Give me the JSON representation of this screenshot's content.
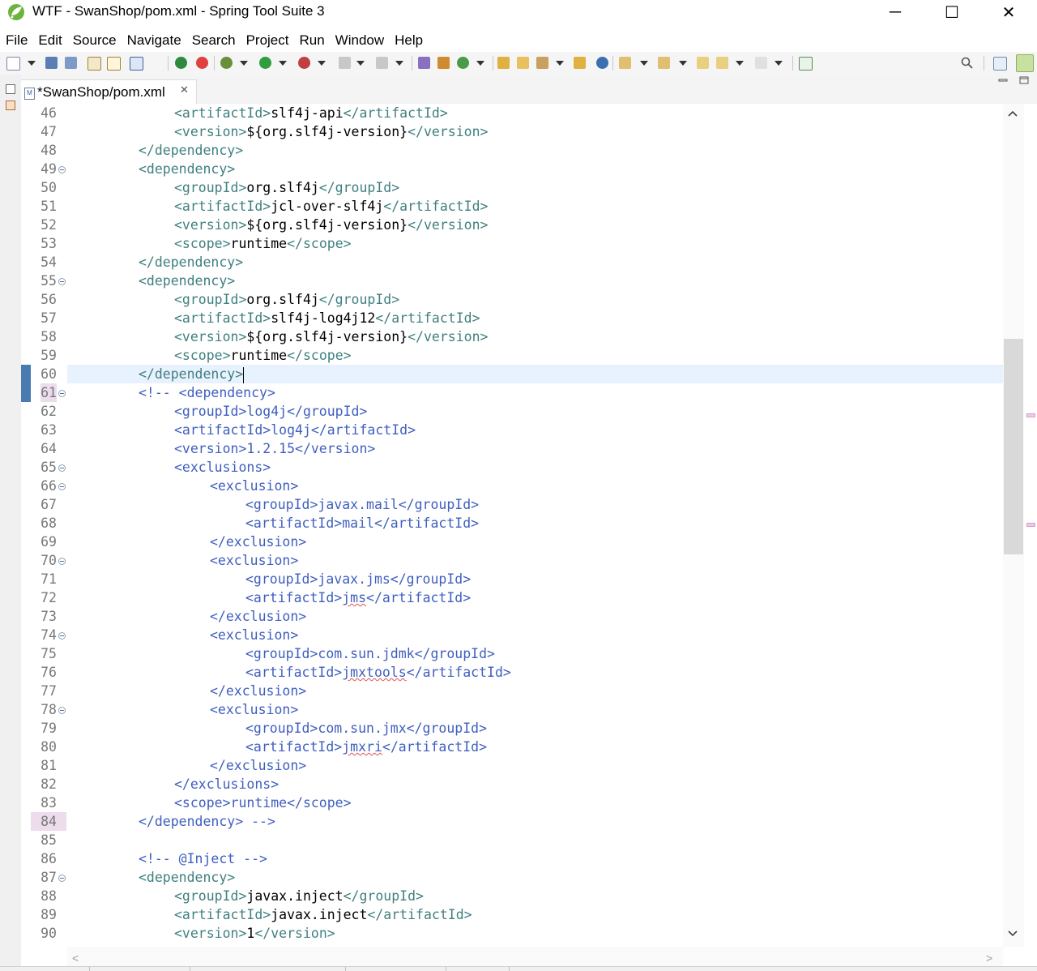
{
  "window": {
    "title": "WTF - SwanShop/pom.xml - Spring Tool Suite 3",
    "minimize_glyph": "─",
    "maximize_glyph": "☐",
    "close_glyph": "✕"
  },
  "menu": [
    "File",
    "Edit",
    "Source",
    "Navigate",
    "Search",
    "Project",
    "Run",
    "Window",
    "Help"
  ],
  "editor_tab": {
    "title": "*SwanShop/pom.xml",
    "file_icon_text": "M",
    "close_glyph": "✕"
  },
  "colors": {
    "tag": "#3f7f7f",
    "text": "#000000",
    "comment": "#3f5fbf",
    "current_line": "#e8f2fe",
    "quick_diff": "#4a7bb0"
  },
  "icons": [
    "spring-logo-icon",
    "new-icon",
    "save-icon",
    "save-all-icon",
    "print-icon",
    "console-icon",
    "skip-breakpoints-icon",
    "debug-icon",
    "run-icon",
    "external-tools-icon",
    "terminate-icon",
    "disconnect-icon",
    "new-class-icon",
    "open-type-icon",
    "refresh-icon",
    "open-folder-icon",
    "search-icon",
    "back-icon",
    "forward-icon",
    "perspective-icon"
  ],
  "editor": {
    "current_line": 60,
    "lines": [
      {
        "n": "46",
        "indent": 3,
        "parts": [
          {
            "t": "<artifactId>",
            "c": "tag"
          },
          {
            "t": "slf4j-api",
            "c": "txt"
          },
          {
            "t": "</artifactId>",
            "c": "tag"
          }
        ]
      },
      {
        "n": "47",
        "indent": 3,
        "parts": [
          {
            "t": "<version>",
            "c": "tag"
          },
          {
            "t": "${org.slf4j-version}",
            "c": "txt"
          },
          {
            "t": "</version>",
            "c": "tag"
          }
        ]
      },
      {
        "n": "48",
        "indent": 2,
        "parts": [
          {
            "t": "</dependency>",
            "c": "tag"
          }
        ]
      },
      {
        "n": "49",
        "indent": 2,
        "fold": true,
        "parts": [
          {
            "t": "<dependency>",
            "c": "tag"
          }
        ]
      },
      {
        "n": "50",
        "indent": 3,
        "parts": [
          {
            "t": "<groupId>",
            "c": "tag"
          },
          {
            "t": "org.slf4j",
            "c": "txt"
          },
          {
            "t": "</groupId>",
            "c": "tag"
          }
        ]
      },
      {
        "n": "51",
        "indent": 3,
        "parts": [
          {
            "t": "<artifactId>",
            "c": "tag"
          },
          {
            "t": "jcl-over-slf4j",
            "c": "txt"
          },
          {
            "t": "</artifactId>",
            "c": "tag"
          }
        ]
      },
      {
        "n": "52",
        "indent": 3,
        "parts": [
          {
            "t": "<version>",
            "c": "tag"
          },
          {
            "t": "${org.slf4j-version}",
            "c": "txt"
          },
          {
            "t": "</version>",
            "c": "tag"
          }
        ]
      },
      {
        "n": "53",
        "indent": 3,
        "parts": [
          {
            "t": "<scope>",
            "c": "tag"
          },
          {
            "t": "runtime",
            "c": "txt"
          },
          {
            "t": "</scope>",
            "c": "tag"
          }
        ]
      },
      {
        "n": "54",
        "indent": 2,
        "parts": [
          {
            "t": "</dependency>",
            "c": "tag"
          }
        ]
      },
      {
        "n": "55",
        "indent": 2,
        "fold": true,
        "parts": [
          {
            "t": "<dependency>",
            "c": "tag"
          }
        ]
      },
      {
        "n": "56",
        "indent": 3,
        "parts": [
          {
            "t": "<groupId>",
            "c": "tag"
          },
          {
            "t": "org.slf4j",
            "c": "txt"
          },
          {
            "t": "</groupId>",
            "c": "tag"
          }
        ]
      },
      {
        "n": "57",
        "indent": 3,
        "parts": [
          {
            "t": "<artifactId>",
            "c": "tag"
          },
          {
            "t": "slf4j-log4j12",
            "c": "txt"
          },
          {
            "t": "</artifactId>",
            "c": "tag"
          }
        ]
      },
      {
        "n": "58",
        "indent": 3,
        "parts": [
          {
            "t": "<version>",
            "c": "tag"
          },
          {
            "t": "${org.slf4j-version}",
            "c": "txt"
          },
          {
            "t": "</version>",
            "c": "tag"
          }
        ]
      },
      {
        "n": "59",
        "indent": 3,
        "parts": [
          {
            "t": "<scope>",
            "c": "tag"
          },
          {
            "t": "runtime",
            "c": "txt"
          },
          {
            "t": "</scope>",
            "c": "tag"
          }
        ]
      },
      {
        "n": "60",
        "indent": 2,
        "current": true,
        "caret": true,
        "qd": true,
        "parts": [
          {
            "t": "</dependency>",
            "c": "tag"
          }
        ]
      },
      {
        "n": "61",
        "indent": 2,
        "fold": true,
        "qd": true,
        "pinkbg": true,
        "parts": [
          {
            "t": "<!-- <dependency>",
            "c": "cmt"
          }
        ]
      },
      {
        "n": "62",
        "indent": 3,
        "parts": [
          {
            "t": "<groupId>log4j</groupId>",
            "c": "cmt"
          }
        ]
      },
      {
        "n": "63",
        "indent": 3,
        "parts": [
          {
            "t": "<artifactId>log4j</artifactId>",
            "c": "cmt"
          }
        ]
      },
      {
        "n": "64",
        "indent": 3,
        "parts": [
          {
            "t": "<version>1.2.15</version>",
            "c": "cmt"
          }
        ]
      },
      {
        "n": "65",
        "indent": 3,
        "fold": true,
        "parts": [
          {
            "t": "<exclusions>",
            "c": "cmt"
          }
        ]
      },
      {
        "n": "66",
        "indent": 4,
        "fold": true,
        "parts": [
          {
            "t": "<exclusion>",
            "c": "cmt"
          }
        ]
      },
      {
        "n": "67",
        "indent": 5,
        "parts": [
          {
            "t": "<groupId>javax.mail</groupId>",
            "c": "cmt"
          }
        ]
      },
      {
        "n": "68",
        "indent": 5,
        "parts": [
          {
            "t": "<artifactId>mail</artifactId>",
            "c": "cmt"
          }
        ]
      },
      {
        "n": "69",
        "indent": 4,
        "parts": [
          {
            "t": "</exclusion>",
            "c": "cmt"
          }
        ]
      },
      {
        "n": "70",
        "indent": 4,
        "fold": true,
        "parts": [
          {
            "t": "<exclusion>",
            "c": "cmt"
          }
        ]
      },
      {
        "n": "71",
        "indent": 5,
        "parts": [
          {
            "t": "<groupId>javax.jms</groupId>",
            "c": "cmt"
          }
        ]
      },
      {
        "n": "72",
        "indent": 5,
        "parts": [
          {
            "t": "<artifactId>",
            "c": "cmt"
          },
          {
            "t": "jms",
            "c": "cmt",
            "sq": true
          },
          {
            "t": "</artifactId>",
            "c": "cmt"
          }
        ]
      },
      {
        "n": "73",
        "indent": 4,
        "parts": [
          {
            "t": "</exclusion>",
            "c": "cmt"
          }
        ]
      },
      {
        "n": "74",
        "indent": 4,
        "fold": true,
        "parts": [
          {
            "t": "<exclusion>",
            "c": "cmt"
          }
        ]
      },
      {
        "n": "75",
        "indent": 5,
        "parts": [
          {
            "t": "<groupId>com.sun.jdmk</groupId>",
            "c": "cmt"
          }
        ]
      },
      {
        "n": "76",
        "indent": 5,
        "parts": [
          {
            "t": "<artifactId>",
            "c": "cmt"
          },
          {
            "t": "jmxtools",
            "c": "cmt",
            "sq": true
          },
          {
            "t": "</artifactId>",
            "c": "cmt"
          }
        ]
      },
      {
        "n": "77",
        "indent": 4,
        "parts": [
          {
            "t": "</exclusion>",
            "c": "cmt"
          }
        ]
      },
      {
        "n": "78",
        "indent": 4,
        "fold": true,
        "parts": [
          {
            "t": "<exclusion>",
            "c": "cmt"
          }
        ]
      },
      {
        "n": "79",
        "indent": 5,
        "parts": [
          {
            "t": "<groupId>com.sun.jmx</groupId>",
            "c": "cmt"
          }
        ]
      },
      {
        "n": "80",
        "indent": 5,
        "parts": [
          {
            "t": "<artifactId>",
            "c": "cmt"
          },
          {
            "t": "jmxri",
            "c": "cmt",
            "sq": true
          },
          {
            "t": "</artifactId>",
            "c": "cmt"
          }
        ]
      },
      {
        "n": "81",
        "indent": 4,
        "parts": [
          {
            "t": "</exclusion>",
            "c": "cmt"
          }
        ]
      },
      {
        "n": "82",
        "indent": 3,
        "parts": [
          {
            "t": "</exclusions>",
            "c": "cmt"
          }
        ]
      },
      {
        "n": "83",
        "indent": 3,
        "parts": [
          {
            "t": "<scope>runtime</scope>",
            "c": "cmt"
          }
        ]
      },
      {
        "n": "84",
        "indent": 2,
        "pinkbg": true,
        "parts": [
          {
            "t": "</dependency> -->",
            "c": "cmt"
          }
        ]
      },
      {
        "n": "85",
        "indent": 0,
        "parts": []
      },
      {
        "n": "86",
        "indent": 2,
        "parts": [
          {
            "t": "<!-- @Inject -->",
            "c": "cmt"
          }
        ]
      },
      {
        "n": "87",
        "indent": 2,
        "fold": true,
        "parts": [
          {
            "t": "<dependency>",
            "c": "tag"
          }
        ]
      },
      {
        "n": "88",
        "indent": 3,
        "parts": [
          {
            "t": "<groupId>",
            "c": "tag"
          },
          {
            "t": "javax.inject",
            "c": "txt"
          },
          {
            "t": "</groupId>",
            "c": "tag"
          }
        ]
      },
      {
        "n": "89",
        "indent": 3,
        "parts": [
          {
            "t": "<artifactId>",
            "c": "tag"
          },
          {
            "t": "javax.inject",
            "c": "txt"
          },
          {
            "t": "</artifactId>",
            "c": "tag"
          }
        ]
      },
      {
        "n": "90",
        "indent": 3,
        "parts": [
          {
            "t": "<version>",
            "c": "tag"
          },
          {
            "t": "1",
            "c": "txt"
          },
          {
            "t": "</version>",
            "c": "tag"
          }
        ]
      }
    ]
  },
  "scrollbars": {
    "up_glyph": "⌃",
    "down_glyph": "⌄",
    "left_glyph": "<",
    "right_glyph": ">"
  }
}
